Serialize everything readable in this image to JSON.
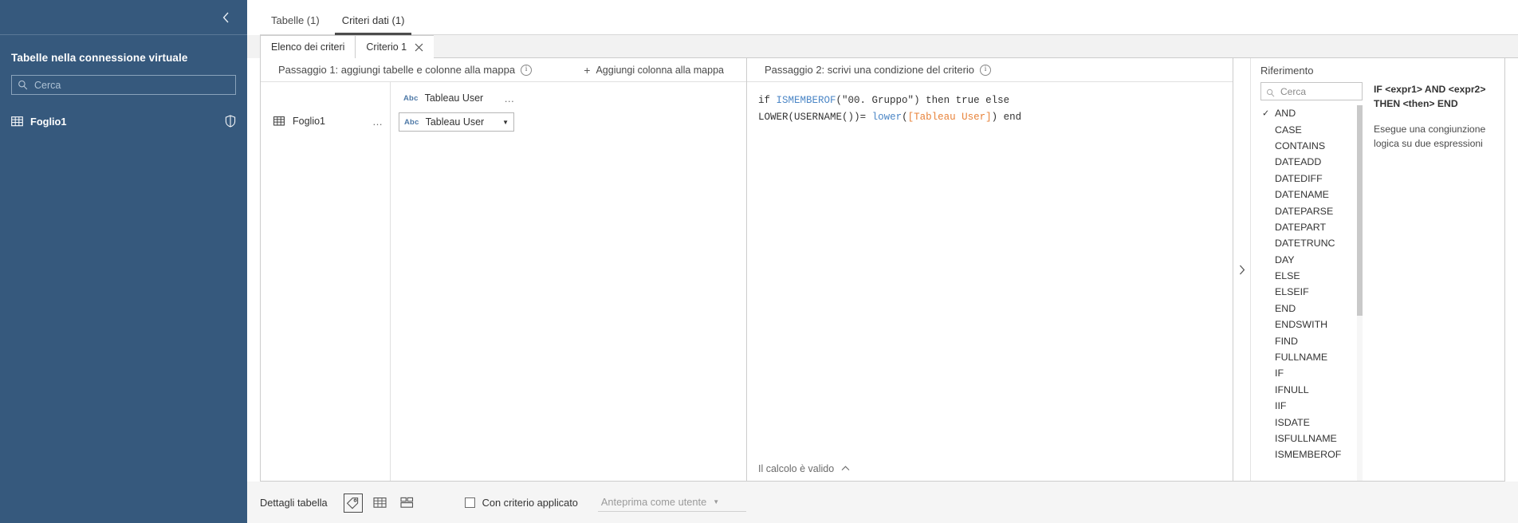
{
  "sidebar": {
    "collapse_icon": "chevron-left-icon",
    "title": "Tabelle nella connessione virtuale",
    "search_placeholder": "Cerca",
    "search_value": "",
    "table_item": {
      "label": "Foglio1",
      "icon": "grid-table-icon",
      "right_icon": "shield-icon"
    }
  },
  "primary_tabs": [
    {
      "label": "Tabelle (1)",
      "active": false
    },
    {
      "label": "Criteri dati (1)",
      "active": true
    }
  ],
  "sub_tabs": [
    {
      "label": "Elenco dei criteri",
      "active": false,
      "closable": false
    },
    {
      "label": "Criterio 1",
      "active": true,
      "closable": true,
      "close_icon": "close-icon"
    }
  ],
  "step1": {
    "title": "Passaggio 1: aggiungi tabelle e colonne alla mappa",
    "info_icon": "info-circle-icon",
    "add_column_label": "Aggiungi colonna alla mappa",
    "add_icon": "plus-icon",
    "table_row": {
      "label": "Foglio1",
      "icon": "grid-table-icon",
      "menu": "…"
    },
    "column_header": {
      "type": "Abc",
      "label": "Tableau User",
      "menu": "…"
    },
    "column_select": {
      "type": "Abc",
      "value": "Tableau User",
      "caret": "▼"
    }
  },
  "step2": {
    "title": "Passaggio 2: scrivi una condizione del criterio",
    "info_icon": "info-circle-icon",
    "formula": {
      "line1": {
        "kw_if": "if ",
        "fn": "ISMEMBEROF",
        "open": "(",
        "str": "\"00. Gruppo\"",
        "close": ")",
        "tail": " then true else"
      },
      "line2": {
        "fn_lower_upper": "LOWER",
        "open1": "(",
        "fn_username": "USERNAME",
        "open2": "()",
        "close1": ")",
        "eq": "= ",
        "fn_lower": "lower",
        "open3": "(",
        "field": "[Tableau User]",
        "close3": ")",
        "tail": " end"
      }
    },
    "validity_text": "Il calcolo è valido",
    "validity_caret": "⌃"
  },
  "reference": {
    "collapse_icon": "chevron-right-icon",
    "title": "Riferimento",
    "search_placeholder": "Cerca",
    "search_value": "",
    "selected": "AND",
    "check_glyph": "✓",
    "items": [
      "AND",
      "CASE",
      "CONTAINS",
      "DATEADD",
      "DATEDIFF",
      "DATENAME",
      "DATEPARSE",
      "DATEPART",
      "DATETRUNC",
      "DAY",
      "ELSE",
      "ELSEIF",
      "END",
      "ENDSWITH",
      "FIND",
      "FULLNAME",
      "IF",
      "IFNULL",
      "IIF",
      "ISDATE",
      "ISFULLNAME",
      "ISMEMBEROF"
    ],
    "syntax": "IF <expr1> AND <expr2> THEN <then> END",
    "description": "Esegue una congiunzione logica su due espressioni"
  },
  "bottom": {
    "details_label": "Dettagli tabella",
    "view_icons": [
      {
        "name": "tag-icon",
        "selected": true
      },
      {
        "name": "grid-table-icon",
        "selected": false
      },
      {
        "name": "layout-icon",
        "selected": false
      }
    ],
    "checkbox_label": "Con criterio applicato",
    "checkbox_checked": false,
    "preview_label": "Anteprima come utente",
    "preview_caret": "▼"
  },
  "colors": {
    "sidebar_bg": "#36597d",
    "accent_field": "#e8833a",
    "accent_function": "#4b86c6",
    "abc_blue": "#4e79a7"
  }
}
